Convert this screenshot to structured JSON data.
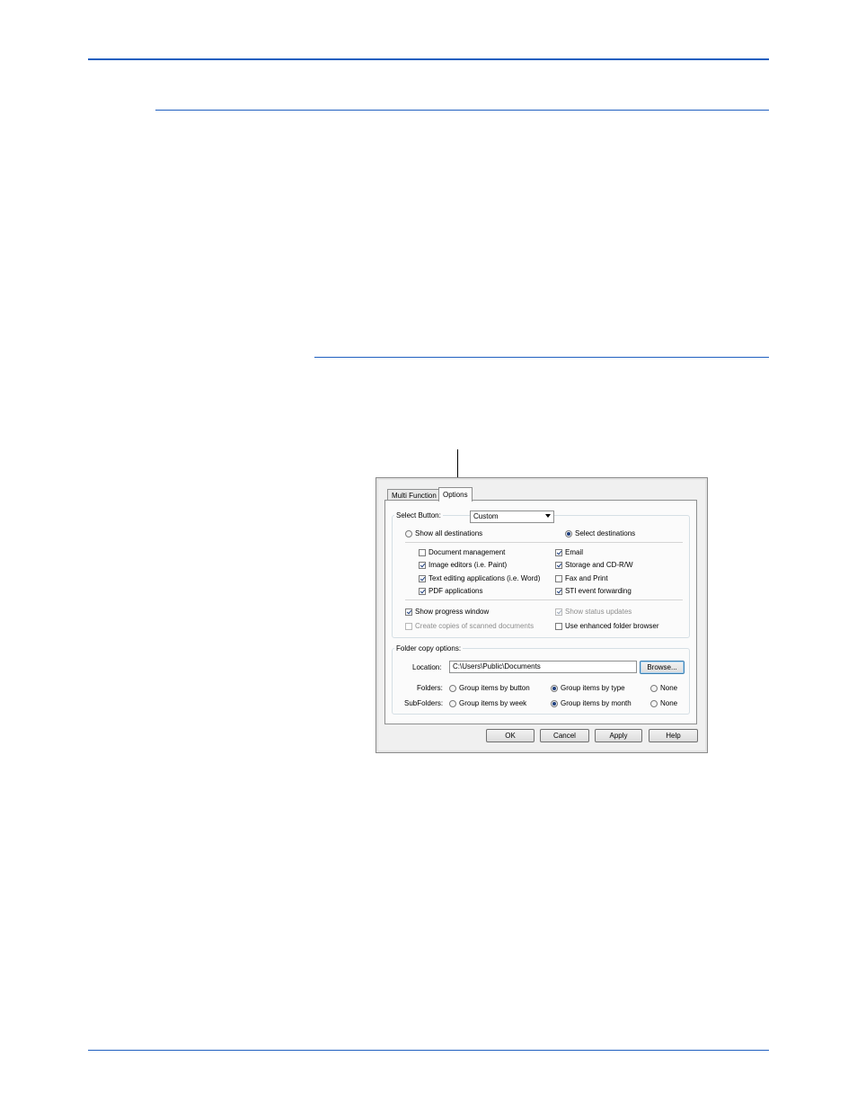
{
  "dialog": {
    "tabs": [
      {
        "label": "Multi Function",
        "active": false
      },
      {
        "label": "Options",
        "active": true
      }
    ],
    "select_button": {
      "label": "Select Button:",
      "value": "Custom"
    },
    "destinations": {
      "show_all": {
        "label": "Show all destinations",
        "selected": false
      },
      "select": {
        "label": "Select destinations",
        "selected": true
      }
    },
    "destination_types_left": [
      {
        "label": "Document management",
        "checked": false
      },
      {
        "label": "Image editors (i.e. Paint)",
        "checked": true
      },
      {
        "label": "Text editing applications (i.e. Word)",
        "checked": true
      },
      {
        "label": "PDF applications",
        "checked": true
      }
    ],
    "destination_types_right": [
      {
        "label": "Email",
        "checked": true
      },
      {
        "label": "Storage and CD-R/W",
        "checked": true
      },
      {
        "label": "Fax and Print",
        "checked": false
      },
      {
        "label": "STI event forwarding",
        "checked": true
      }
    ],
    "general_options": [
      {
        "label": "Show progress window",
        "checked": true,
        "enabled": true
      },
      {
        "label": "Show status updates",
        "checked": true,
        "enabled": false
      },
      {
        "label": "Create copies of scanned documents",
        "checked": false,
        "enabled": false
      },
      {
        "label": "Use enhanced folder browser",
        "checked": false,
        "enabled": true
      }
    ],
    "folder_copy": {
      "legend": "Folder copy options:",
      "location_label": "Location:",
      "location_value": "C:\\Users\\Public\\Documents",
      "browse_label": "Browse...",
      "folders_label": "Folders:",
      "folders_options": [
        {
          "label": "Group items by button",
          "selected": false
        },
        {
          "label": "Group items by type",
          "selected": true
        },
        {
          "label": "None",
          "selected": false
        }
      ],
      "subfolders_label": "SubFolders:",
      "subfolders_options": [
        {
          "label": "Group items by week",
          "selected": false
        },
        {
          "label": "Group items by month",
          "selected": true
        },
        {
          "label": "None",
          "selected": false
        }
      ]
    },
    "buttons": {
      "ok": "OK",
      "cancel": "Cancel",
      "apply": "Apply",
      "help": "Help"
    }
  },
  "colors": {
    "rule": "#1f5fbf",
    "radio_dot": "#1e3f7e"
  }
}
